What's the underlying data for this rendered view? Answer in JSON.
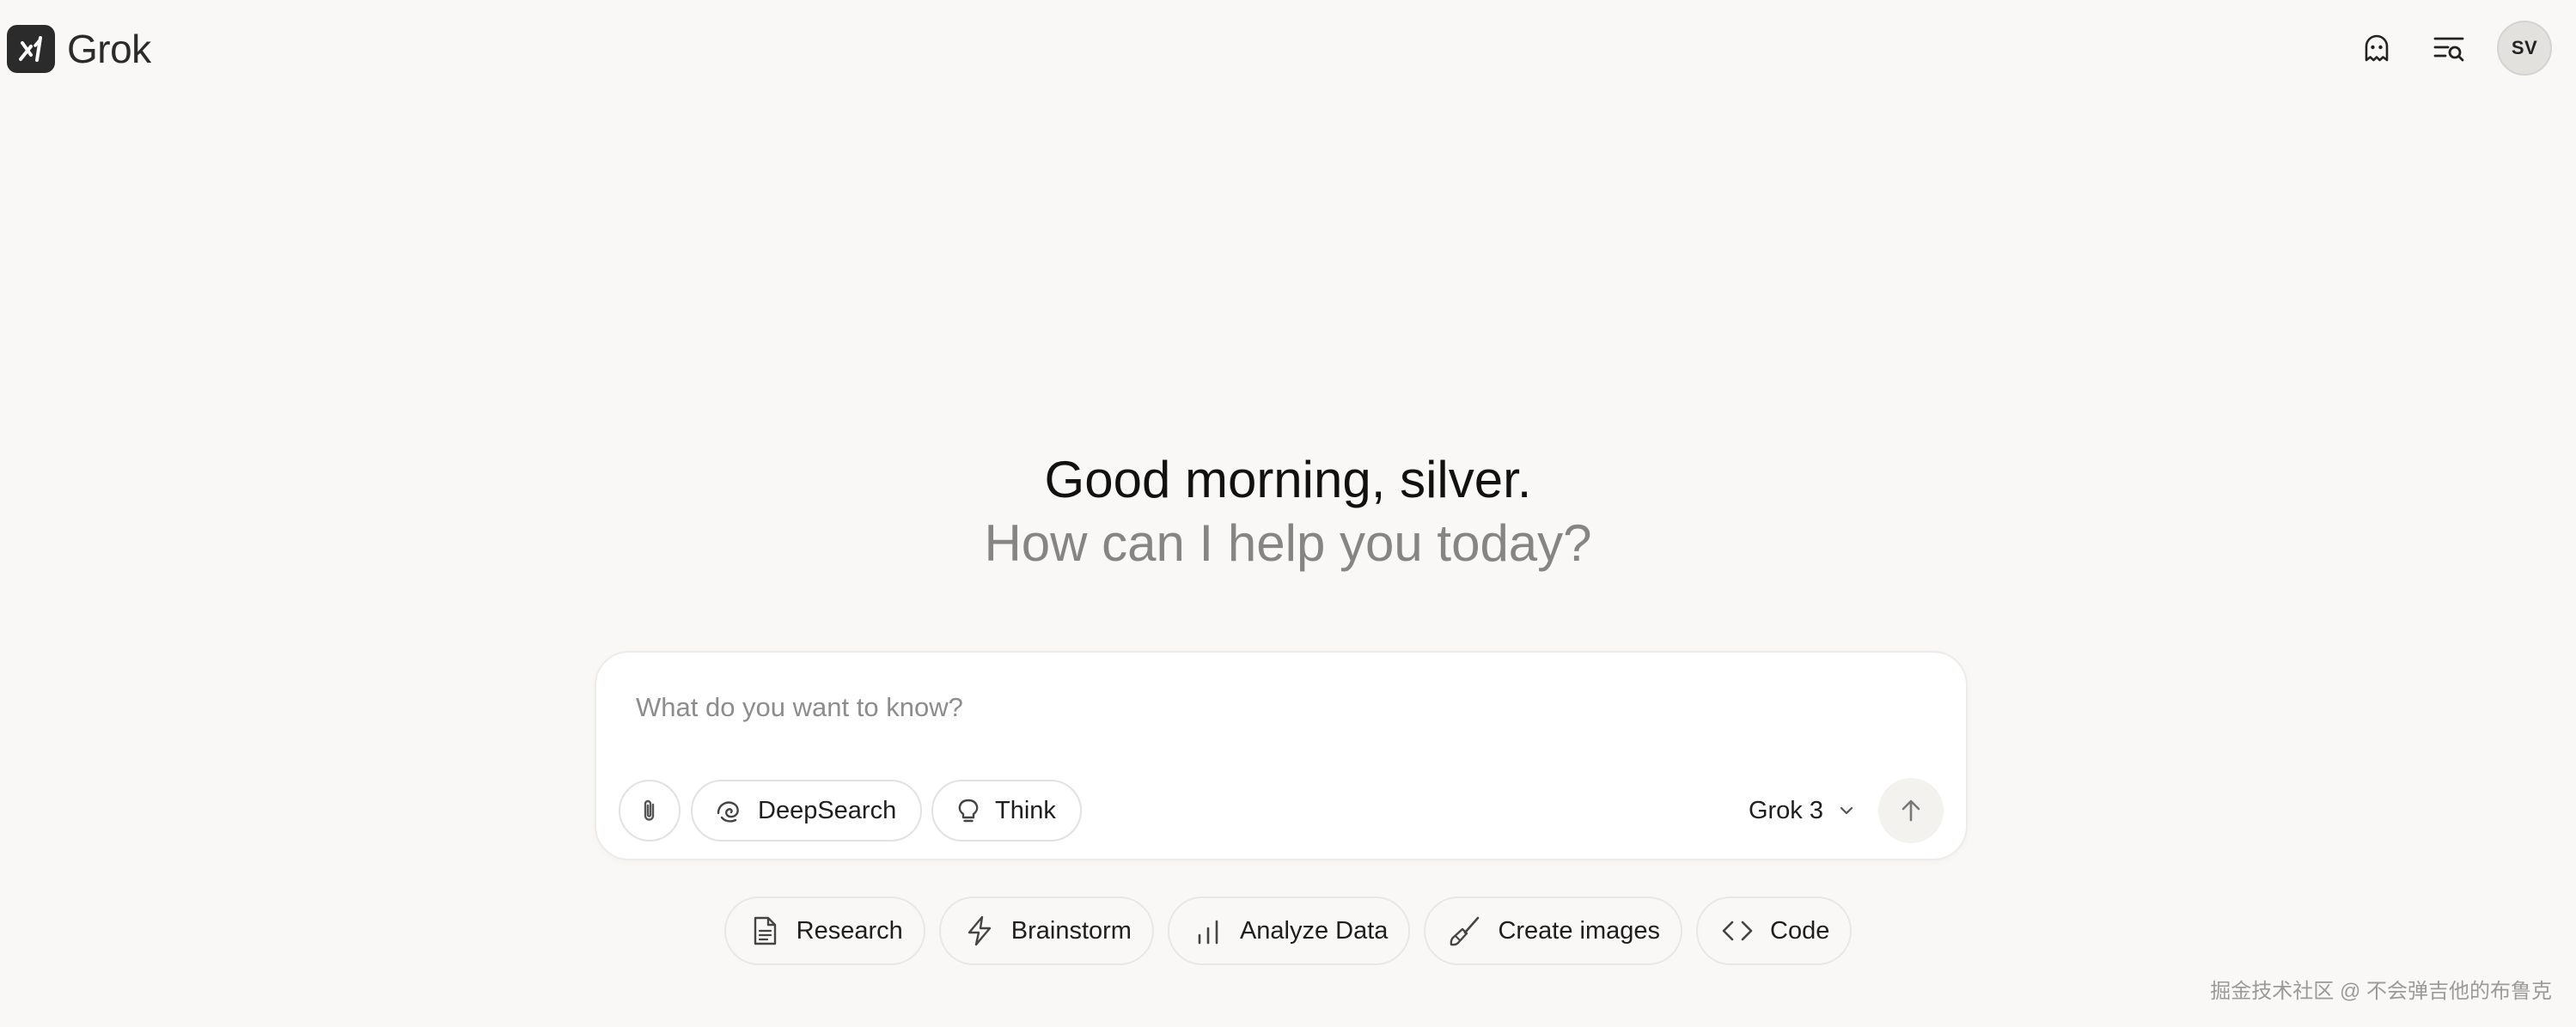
{
  "app": {
    "name": "Grok"
  },
  "header": {
    "icons": [
      "ghost-icon",
      "chat-history-search-icon"
    ],
    "avatar_initials": "SV"
  },
  "greeting": {
    "title": "Good morning, silver.",
    "subtitle": "How can I help you today?"
  },
  "composer": {
    "placeholder": "What do you want to know?",
    "value": "",
    "deepsearch_label": "DeepSearch",
    "think_label": "Think",
    "model_label": "Grok 3"
  },
  "suggestions": [
    {
      "label": "Research",
      "icon": "document-icon"
    },
    {
      "label": "Brainstorm",
      "icon": "lightning-icon"
    },
    {
      "label": "Analyze Data",
      "icon": "bar-chart-icon"
    },
    {
      "label": "Create images",
      "icon": "paintbrush-icon"
    },
    {
      "label": "Code",
      "icon": "code-icon"
    }
  ],
  "watermark": "掘金技术社区 @ 不会弹吉他的布鲁克",
  "colors": {
    "background": "#f9f8f6",
    "logo": "#2b2b2b",
    "subtitle": "#858585"
  }
}
